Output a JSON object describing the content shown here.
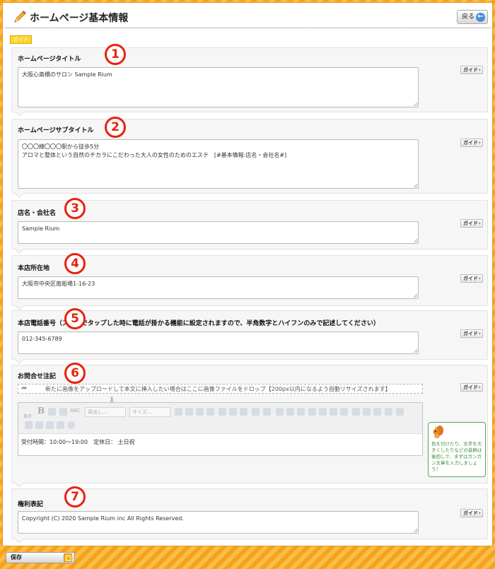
{
  "header": {
    "title": "ホームページ基本情報",
    "back_label": "戻る",
    "guide_tag": "ガイド",
    "icon": "pencil-icon",
    "back_icon": "back-arrow-icon"
  },
  "guide_button_label": "ガイド",
  "sections": [
    {
      "number": "1",
      "label": "ホームページタイトル",
      "value": "大阪心斎橋のサロン Sample Rium"
    },
    {
      "number": "2",
      "label": "ホームページサブタイトル",
      "value": "〇〇〇線〇〇〇駅から徒歩5分\nアロマと整体という自然のチカラにこだわった大人の女性のためのエステ　[#基本情報:店名・会社名#]"
    },
    {
      "number": "3",
      "label": "店名・会社名",
      "value": "Sample Rium"
    },
    {
      "number": "4",
      "label": "本店所在地",
      "value": "大阪市中央区南船場1-16-23"
    },
    {
      "number": "5",
      "label": "本店電話番号",
      "label_suffix": "（スマホでタップした時に電話が掛かる機能に設定されますので、半角数字とハイフンのみで記述してください）",
      "value": "012-345-6789"
    },
    {
      "number": "6",
      "label": "お問合せ注記",
      "upload_text": "新たに画像をアップロードして本文に挿入したい場合はここに画像ファイルをドロップ【200px以内になるよう自動リサイズされます】",
      "toolbar_format_placeholder": "見出し...",
      "toolbar_size_placeholder": "サイズ...",
      "toolbar_dsp": "表示",
      "toolbar_abc": "ABC",
      "toolbar_b": "B",
      "value": "受付時間：10:00〜19:00　定休日： 土日祝",
      "tip": "色を付けたり、文字を大きくしたりなどの装飾は後回しで、まずはガンガン文章を入力しましょう！"
    },
    {
      "number": "7",
      "label": "権利表記",
      "value": "Copyright (C) 2020 Sample Rium inc All Rights Reserved."
    }
  ],
  "footer": {
    "save_label": "保存",
    "save_icon": "lock-icon"
  },
  "colors": {
    "accent_orange": "#f7a21b",
    "number_red": "#e8210c",
    "tip_green": "#3a8a3a"
  }
}
